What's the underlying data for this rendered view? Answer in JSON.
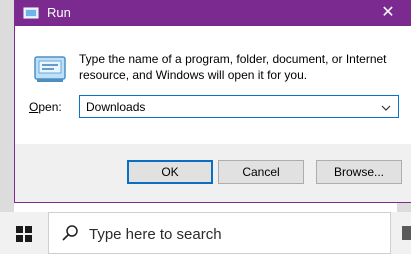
{
  "dialog": {
    "title": "Run",
    "close_glyph": "✕",
    "description": "Type the name of a program, folder, document, or Internet resource, and Windows will open it for you.",
    "open_label_accel": "O",
    "open_label_rest": "pen:",
    "open_value": "Downloads",
    "buttons": {
      "ok": "OK",
      "cancel": "Cancel",
      "browse": "Browse..."
    },
    "icons": [
      "run-app-icon",
      "run-large-icon",
      "chevron-down-icon",
      "close-icon"
    ]
  },
  "taskbar": {
    "search_placeholder": "Type here to search",
    "icons": [
      "windows-start-icon",
      "search-icon"
    ]
  },
  "colors": {
    "titlebar": "#7b2b90",
    "accent": "#0a74c9"
  }
}
